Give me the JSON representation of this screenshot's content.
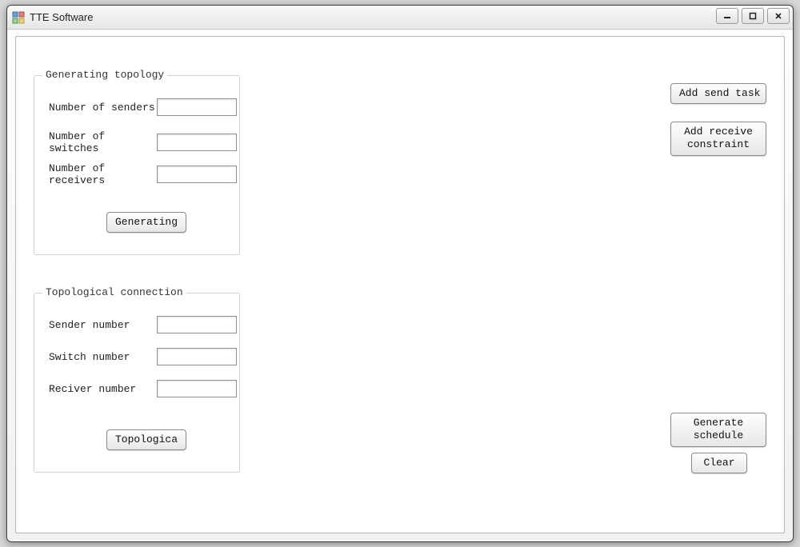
{
  "window": {
    "title": "TTE Software"
  },
  "group1": {
    "legend": "Generating topology",
    "field1_label": "Number of senders",
    "field1_value": "",
    "field2_label": "Number of switches",
    "field2_value": "",
    "field3_label": "Number of receivers",
    "field3_value": "",
    "button_label": "Generating"
  },
  "group2": {
    "legend": "Topological connection",
    "field1_label": "Sender number",
    "field1_value": "",
    "field2_label": "Switch number",
    "field2_value": "",
    "field3_label": "Reciver number",
    "field3_value": "",
    "button_label": "Topologica"
  },
  "side": {
    "add_send_task": "Add send task",
    "add_receive_constraint": "Add receive\nconstraint",
    "generate_schedule": "Generate\nschedule",
    "clear": "Clear"
  }
}
